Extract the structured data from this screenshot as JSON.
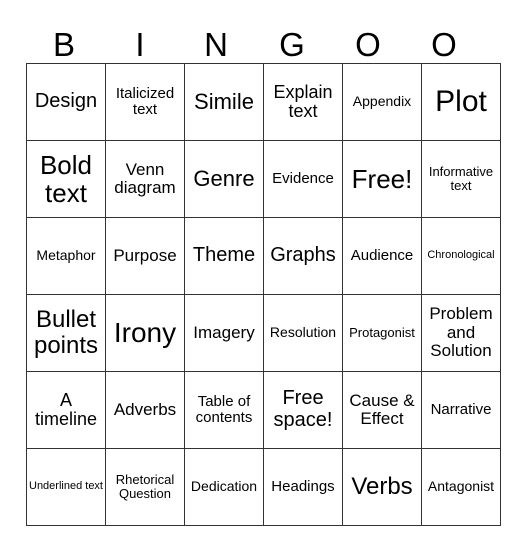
{
  "header": [
    "B",
    "I",
    "N",
    "G",
    "O",
    "O"
  ],
  "rows": [
    [
      "Design",
      "Italicized text",
      "Simile",
      "Explain text",
      "Appendix",
      "Plot"
    ],
    [
      "Bold text",
      "Venn diagram",
      "Genre",
      "Evidence",
      "Free!",
      "Informative text"
    ],
    [
      "Metaphor",
      "Purpose",
      "Theme",
      "Graphs",
      "Audience",
      "Chronological"
    ],
    [
      "Bullet points",
      "Irony",
      "Imagery",
      "Resolution",
      "Protagonist",
      "Problem and Solution"
    ],
    [
      "A timeline",
      "Adverbs",
      "Table of contents",
      "Free space!",
      "Cause & Effect",
      "Narrative"
    ],
    [
      "Underlined text",
      "Rhetorical Question",
      "Dedication",
      "Headings",
      "Verbs",
      "Antagonist"
    ]
  ]
}
